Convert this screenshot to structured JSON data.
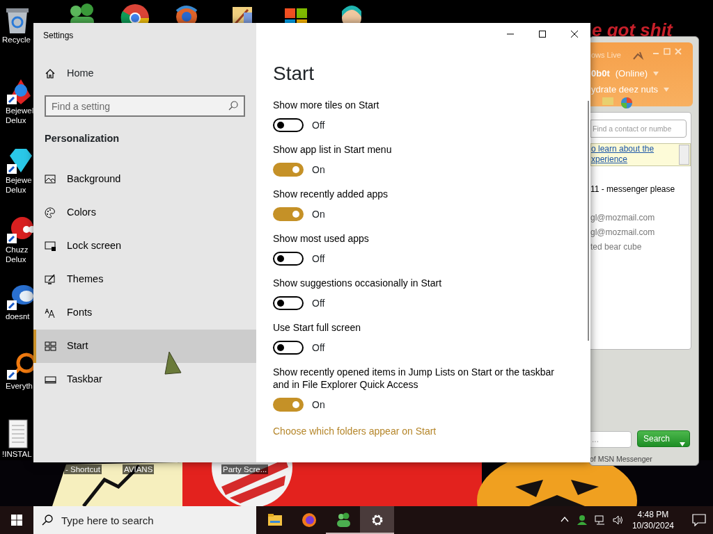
{
  "desktop": {
    "wallpaper_text": "e got shit",
    "left_icons": [
      {
        "lines": [
          "Recycle"
        ]
      },
      {
        "lines": [
          "Bejewel",
          "Delux"
        ]
      },
      {
        "lines": [
          "Bejewe",
          "Delux"
        ]
      },
      {
        "lines": [
          "Chuzz",
          "Delux"
        ]
      },
      {
        "lines": [
          "doesnt"
        ]
      },
      {
        "lines": [
          "Everyth"
        ]
      },
      {
        "lines": [
          "!INSTAL"
        ]
      }
    ],
    "bottom_labels": [
      "- Shortcut",
      "AVIANS",
      "Party Scre..."
    ]
  },
  "msn": {
    "title": "ows Live",
    "user": "0b0t",
    "status": "(Online)",
    "message": "ydrate deez nuts",
    "search": {
      "placeholder": "Find a contact or numbe"
    },
    "banner_lines": [
      "o learn about the",
      "xperience"
    ],
    "contacts": [
      {
        "text": "11 - messenger please",
        "kind": "group"
      },
      {
        "text": "gl@mozmail.com",
        "kind": "contact"
      },
      {
        "text": "gl@mozmail.com",
        "kind": "contact"
      },
      {
        "text": "ted bear cube",
        "kind": "contact"
      }
    ],
    "web_field": {
      "placeholder": "..."
    },
    "search_button": "Search",
    "footer": "of MSN Messenger"
  },
  "settings": {
    "title": "Settings",
    "home": "Home",
    "search": {
      "placeholder": "Find a setting"
    },
    "section": "Personalization",
    "nav": [
      {
        "label": "Background",
        "selected": false
      },
      {
        "label": "Colors",
        "selected": false
      },
      {
        "label": "Lock screen",
        "selected": false
      },
      {
        "label": "Themes",
        "selected": false
      },
      {
        "label": "Fonts",
        "selected": false
      },
      {
        "label": "Start",
        "selected": true
      },
      {
        "label": "Taskbar",
        "selected": false
      }
    ],
    "heading": "Start",
    "options": [
      {
        "label": "Show more tiles on Start",
        "on": false,
        "state_label": "Off"
      },
      {
        "label": "Show app list in Start menu",
        "on": true,
        "state_label": "On"
      },
      {
        "label": "Show recently added apps",
        "on": true,
        "state_label": "On"
      },
      {
        "label": "Show most used apps",
        "on": false,
        "state_label": "Off"
      },
      {
        "label": "Show suggestions occasionally in Start",
        "on": false,
        "state_label": "Off"
      },
      {
        "label": "Use Start full screen",
        "on": false,
        "state_label": "Off"
      },
      {
        "label": "Show recently opened items in Jump Lists on Start or the taskbar and in File Explorer Quick Access",
        "on": true,
        "state_label": "On"
      }
    ],
    "link": "Choose which folders appear on Start"
  },
  "taskbar": {
    "search": {
      "placeholder": "Type here to search"
    },
    "apps": [
      {
        "running": false,
        "selected": false
      },
      {
        "running": false,
        "selected": false
      },
      {
        "running": true,
        "selected": false
      },
      {
        "running": true,
        "selected": true
      }
    ],
    "time": "4:48 PM",
    "date": "10/30/2024"
  }
}
